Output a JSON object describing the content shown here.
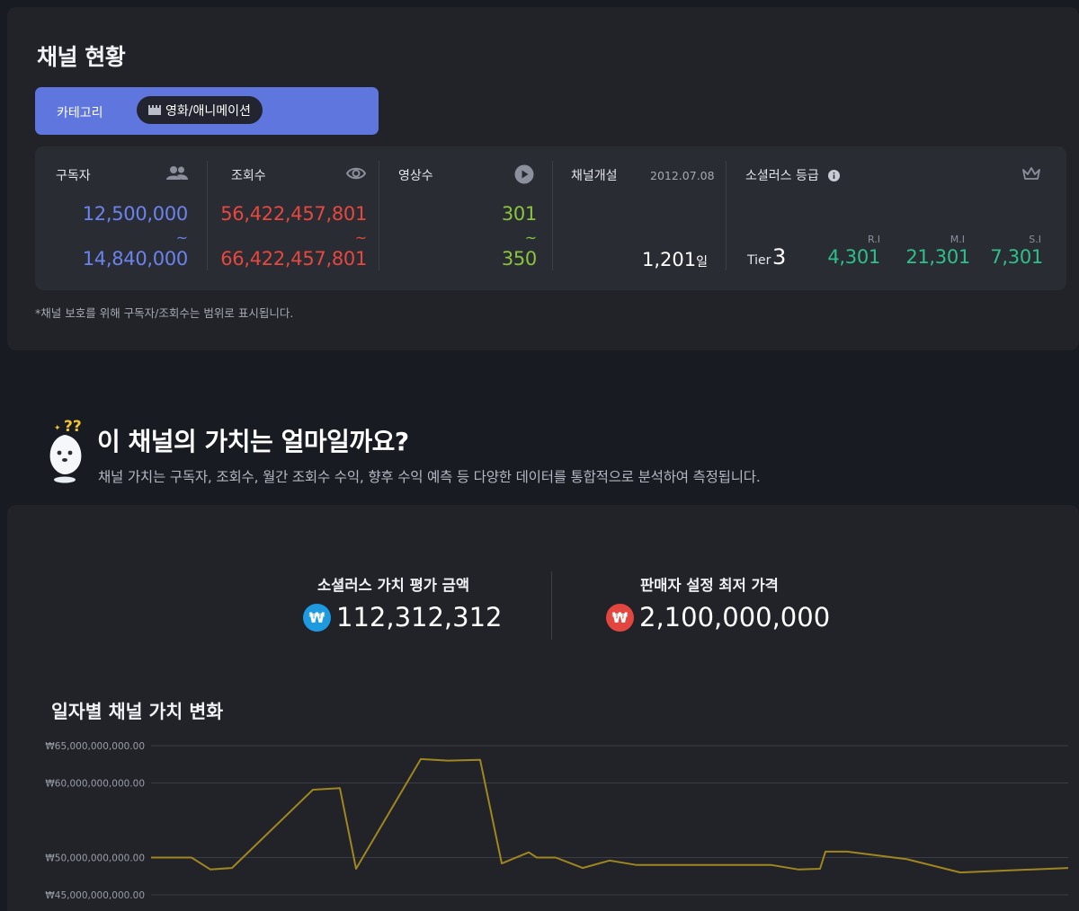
{
  "status_section": {
    "title": "채널 현황",
    "category": {
      "label": "카테고리",
      "value": "영화/애니메이션",
      "icon": "clapperboard-icon"
    },
    "stats": {
      "subscribers": {
        "label": "구독자",
        "min": "12,500,000",
        "tilde": "~",
        "max": "14,840,000",
        "icon": "people-icon"
      },
      "views": {
        "label": "조회수",
        "min": "56,422,457,801",
        "tilde": "~",
        "max": "66,422,457,801",
        "icon": "eye-icon"
      },
      "videos": {
        "label": "영상수",
        "min": "301",
        "tilde": "~",
        "max": "350",
        "icon": "play-icon"
      },
      "opened": {
        "label": "채널개설",
        "date": "2012.07.08",
        "days": "1,201",
        "days_unit": "일"
      },
      "grade": {
        "label": "소셜러스 등급",
        "info_icon": "info-icon",
        "crown_icon": "crown-icon",
        "tier_label": "Tier",
        "tier_value": "3",
        "indices": [
          {
            "label": "R.I",
            "value": "4,301"
          },
          {
            "label": "M.I",
            "value": "21,301"
          },
          {
            "label": "S.I",
            "value": "7,301"
          }
        ]
      }
    },
    "note": "*채널 보호를 위해 구독자/조회수는 범위로 표시됩니다."
  },
  "value_section": {
    "title": "이 채널의 가치는 얼마일까요?",
    "description": "채널 가치는 구독자, 조회수, 월간 조회수 수익, 향후 수익 예측 등 다양한 데이터를 통합적으로 분석하여 측정됩니다.",
    "mascot_icon": "question-mascot-icon",
    "evaluation": {
      "label": "소셜러스 가치 평가 금액",
      "amount": "112,312,312",
      "currency": "₩"
    },
    "seller_price": {
      "label": "판매자 설정 최저 가격",
      "amount": "2,100,000,000",
      "currency": "₩"
    }
  },
  "colors": {
    "background": "#191b22",
    "panel": "#212329",
    "card": "#2a2c33",
    "accent": "#5f76df",
    "blue": "#6b83ec",
    "red": "#e5483f",
    "green": "#8ac43d",
    "teal": "#2fc08a",
    "line": "#a0861e"
  },
  "chart_data": {
    "type": "line",
    "title": "일자별 채널 가치 변화",
    "ylabel": "",
    "xlabel": "",
    "ylim": [
      45000000000,
      65000000000
    ],
    "yticks": [
      {
        "value": 65000000000,
        "label": "₩65,000,000,000.00"
      },
      {
        "value": 60000000000,
        "label": "₩60,000,000,000.00"
      },
      {
        "value": 50000000000,
        "label": "₩50,000,000,000.00"
      },
      {
        "value": 45000000000,
        "label": "₩45,000,000,000.00"
      }
    ],
    "grid": true,
    "series": [
      {
        "values": [
          [
            0,
            50000000000
          ],
          [
            1.5,
            50000000000
          ],
          [
            2.2,
            48400000000
          ],
          [
            3.0,
            48600000000
          ],
          [
            6.0,
            59100000000
          ],
          [
            7.0,
            59300000000
          ],
          [
            7.6,
            48500000000
          ],
          [
            10.0,
            63200000000
          ],
          [
            11.0,
            63000000000
          ],
          [
            12.2,
            63100000000
          ],
          [
            13.0,
            49200000000
          ],
          [
            14.0,
            50700000000
          ],
          [
            14.3,
            50000000000
          ],
          [
            15.0,
            50000000000
          ],
          [
            16.0,
            48600000000
          ],
          [
            17.0,
            49600000000
          ],
          [
            18.0,
            49000000000
          ],
          [
            23.0,
            49000000000
          ],
          [
            24.0,
            48400000000
          ],
          [
            24.8,
            48500000000
          ],
          [
            25.0,
            50800000000
          ],
          [
            25.8,
            50800000000
          ],
          [
            28.0,
            49800000000
          ],
          [
            30.0,
            48000000000
          ],
          [
            34.0,
            48600000000
          ]
        ]
      }
    ]
  }
}
